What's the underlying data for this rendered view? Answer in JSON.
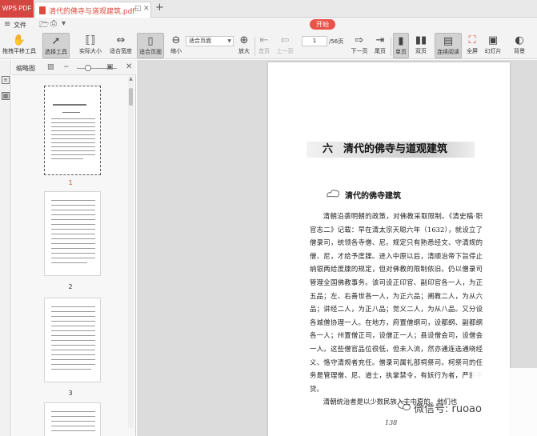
{
  "titlebar": {
    "app_name": "WPS PDF",
    "doc_tab_name": "清代的佛寺与道观建筑.pdf",
    "new_tab": "+"
  },
  "menu": {
    "file": "文件",
    "start": "开始"
  },
  "toolbar": {
    "hand_tool": "拖拽平移工具",
    "select_tool": "选择工具",
    "actual_size": "实际大小",
    "fit_width": "适合宽度",
    "fit_page": "适合页面",
    "zoom_out": "缩小",
    "zoom_select": "适合页面",
    "zoom_in": "放大",
    "first_page": "首页",
    "prev_page": "上一页",
    "page_current": "1",
    "page_total": "/56页",
    "next_page": "下一页",
    "last_page": "尾页",
    "single_page": "单页",
    "double_page": "双页",
    "continuous": "连续阅读",
    "fullscreen": "全屏",
    "slideshow": "幻灯片",
    "background": "背景"
  },
  "thumbnail_panel": {
    "title": "缩略图",
    "pages": [
      {
        "number": "1",
        "selected": true
      },
      {
        "number": "2",
        "selected": false
      },
      {
        "number": "3",
        "selected": false
      }
    ]
  },
  "document": {
    "chapter_title": "六　清代的佛寺与道观建筑",
    "section_title": "清代的佛寺建筑",
    "paragraph_1": "清朝沿袭明朝的政策，对佛教采取限制。《清史稿·职官志二》记载：早在清太宗天聪六年（1632），就设立了僧录司，统领各寺僧、尼。规定只有熟悉经文、守清规的僧、尼，才给予度牒。进入中原以后，清顺治帝下旨停止纳银两给度牒的规定，但对佛教的限制依旧。仍以僧录司管理全国佛教事务。该司设正印官、副印官各一人，为正五品；左、右善世各一人，为正六品；阐教二人，为从六品；讲经二人，为正八品；觉义二人，为从八品。又分设各城僧协理一人。在地方，府置僧纲司，设都纲、副都纲各一人；州置僧正司，设僧正一人；县设僧会司，设僧会一人。这些僧官品位很低，但未入流，然亦通连选通晓经义、恪守清规者充任。僧录司属礼部祠祭司。柯祭司的任务是管理僧、尼、道士，执掌禁令，有妖行为者，严惩不贷。",
    "paragraph_2": "清朝统治者是以少数民族入主中原的，他们也",
    "page_number": "138"
  },
  "watermark": {
    "text": "微信号: ruoao"
  }
}
